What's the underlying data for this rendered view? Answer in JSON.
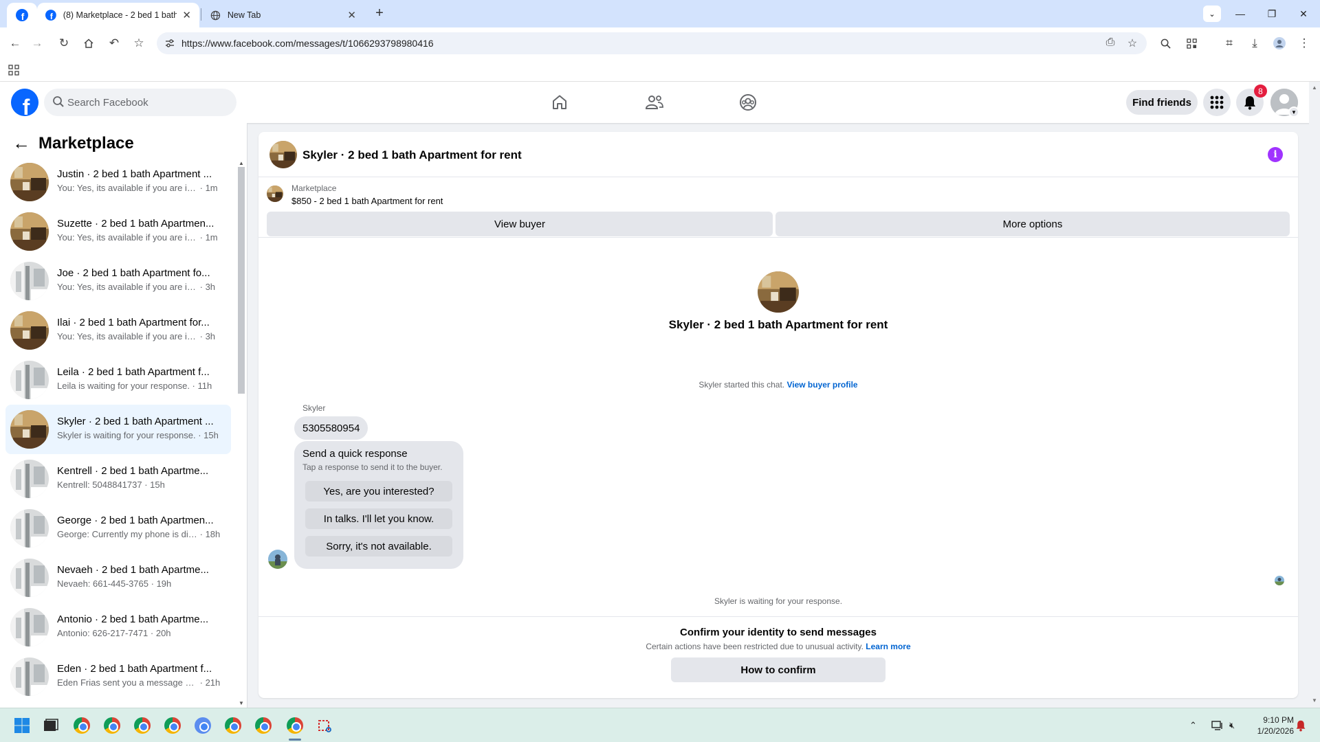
{
  "browser": {
    "tabs": [
      {
        "title": "(8) Marketplace - 2 bed 1 bath",
        "favicon": "facebook-icon",
        "active": true
      },
      {
        "title": "New Tab",
        "favicon": "globe-icon",
        "active": false
      }
    ],
    "url": "https://www.facebook.com/messages/t/1066293798980416"
  },
  "fb_header": {
    "search_placeholder": "Search Facebook",
    "find_friends_label": "Find friends",
    "notification_count": "8",
    "accent_color": "#0866ff"
  },
  "sidebar": {
    "title": "Marketplace",
    "conversations": [
      {
        "title": "Justin · 2 bed 1 bath Apartment ...",
        "preview": "You: Yes, its available if you are int...",
        "time": "1m",
        "avatar": "room"
      },
      {
        "title": "Suzette · 2 bed 1 bath Apartmen...",
        "preview": "You: Yes, its available if you are int...",
        "time": "1m",
        "avatar": "room"
      },
      {
        "title": "Joe · 2 bed 1 bath Apartment fo...",
        "preview": "You: Yes, its available if you are inte...",
        "time": "3h",
        "avatar": "bath"
      },
      {
        "title": "Ilai · 2 bed 1 bath Apartment for...",
        "preview": "You: Yes, its available if you are inte...",
        "time": "3h",
        "avatar": "room"
      },
      {
        "title": "Leila · 2 bed 1 bath Apartment f...",
        "preview": "Leila is waiting for your response.",
        "time": "11h",
        "avatar": "bath"
      },
      {
        "title": "Skyler · 2 bed 1 bath Apartment ...",
        "preview": "Skyler is waiting for your response.",
        "time": "15h",
        "avatar": "room",
        "selected": true
      },
      {
        "title": "Kentrell · 2 bed 1 bath Apartme...",
        "preview": "Kentrell: 5048841737",
        "time": "15h",
        "avatar": "bath"
      },
      {
        "title": "George · 2 bed 1 bath Apartmen...",
        "preview": "George: Currently my phone is dis...",
        "time": "18h",
        "avatar": "bath"
      },
      {
        "title": "Nevaeh · 2 bed 1 bath Apartme...",
        "preview": "Nevaeh: 661-445-3765",
        "time": "19h",
        "avatar": "bath"
      },
      {
        "title": "Antonio · 2 bed 1 bath Apartme...",
        "preview": "Antonio: 626-217-7471",
        "time": "20h",
        "avatar": "bath"
      },
      {
        "title": "Eden · 2 bed 1 bath Apartment f...",
        "preview": "Eden Frias sent you a message ab...",
        "time": "21h",
        "avatar": "bath"
      }
    ]
  },
  "chat": {
    "title": "Skyler · 2 bed 1 bath Apartment for rent",
    "listing_source": "Marketplace",
    "listing_title": "$850 - 2 bed 1 bath Apartment for rent",
    "view_buyer_label": "View buyer",
    "more_options_label": "More options",
    "center_name": "Skyler · 2 bed 1 bath Apartment for rent",
    "started_text": "Skyler started this chat.",
    "view_buyer_profile_link": "View buyer profile",
    "sender_name": "Skyler",
    "message_text": "5305580954",
    "quick_title": "Send a quick response",
    "quick_subtitle": "Tap a response to send it to the buyer.",
    "quick_responses": [
      "Yes, are you interested?",
      "In talks. I'll let you know.",
      "Sorry, it's not available."
    ],
    "waiting_text": "Skyler is waiting for your response.",
    "confirm_title": "Confirm your identity to send messages",
    "confirm_subtitle": "Certain actions have been restricted due to unusual activity.",
    "learn_more_link": "Learn more",
    "how_to_confirm_label": "How to confirm"
  },
  "taskbar": {
    "time": "9:10 PM",
    "date": "1/20/2026"
  }
}
